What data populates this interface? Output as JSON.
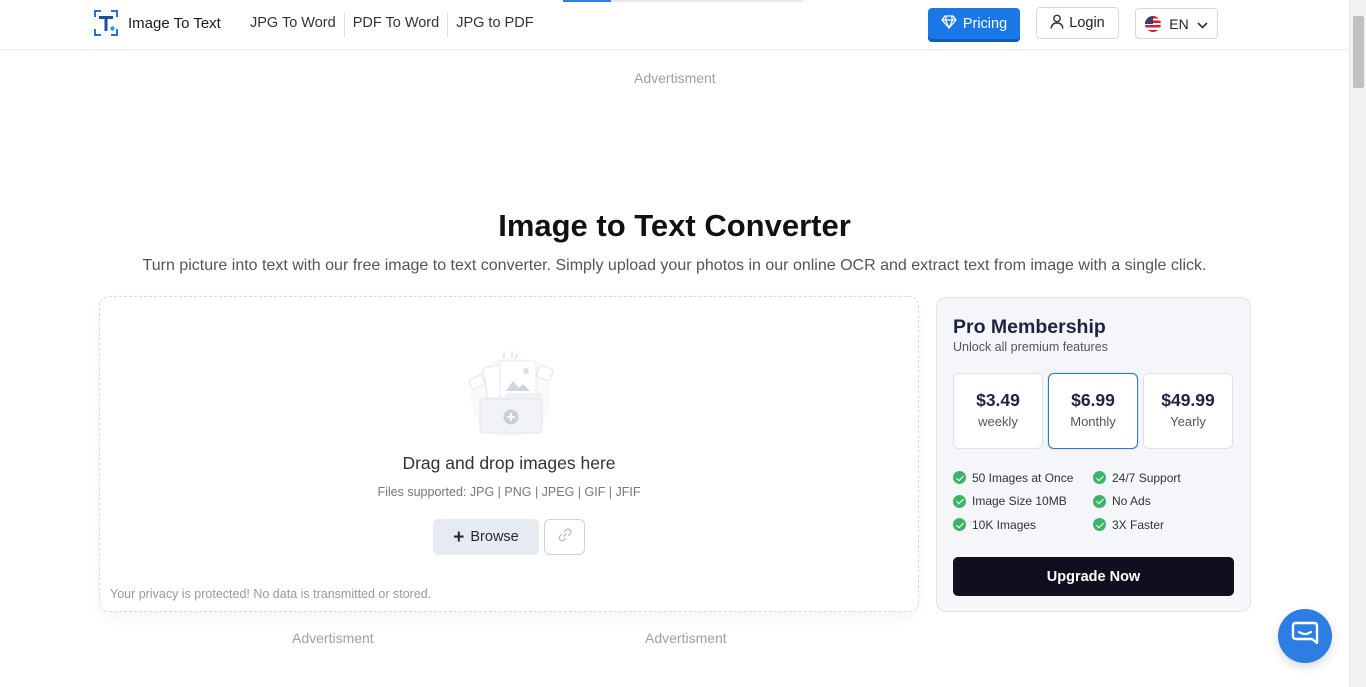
{
  "header": {
    "logo_text": "Image To Text",
    "nav": [
      {
        "label": "JPG To Word"
      },
      {
        "label": "PDF To Word"
      },
      {
        "label": "JPG to PDF"
      }
    ],
    "pricing_label": "Pricing",
    "login_label": "Login",
    "language": "EN",
    "colors": {
      "accent": "#1a78e6"
    }
  },
  "ads": {
    "top": "Advertisment",
    "bottom_left": "Advertisment",
    "bottom_right": "Advertisment"
  },
  "hero": {
    "title": "Image to Text Converter",
    "subtitle": "Turn picture into text with our free image to text converter. Simply upload your photos in our online OCR and extract text from image with a single click."
  },
  "upload": {
    "drop_text": "Drag and drop images here",
    "files_supported": "Files supported: JPG | PNG | JPEG | GIF | JFIF",
    "browse_label": "Browse",
    "privacy": "Your privacy is protected! No data is transmitted or stored."
  },
  "pro": {
    "title": "Pro Membership",
    "subtitle": "Unlock all premium features",
    "plans": [
      {
        "price": "$3.49",
        "period": "weekly"
      },
      {
        "price": "$6.99",
        "period": "Monthly"
      },
      {
        "price": "$49.99",
        "period": "Yearly"
      }
    ],
    "selected_plan": "Monthly",
    "features": [
      {
        "label": "50 Images at Once"
      },
      {
        "label": "24/7 Support"
      },
      {
        "label": "Image Size 10MB"
      },
      {
        "label": "No Ads"
      },
      {
        "label": "10K Images"
      },
      {
        "label": "3X Faster"
      }
    ],
    "upgrade_label": "Upgrade Now",
    "colors": {
      "check": "#3fb468",
      "selected_border": "#2c78d4",
      "upgrade_bg": "#0f0f1f"
    }
  },
  "icons": [
    "logo-icon",
    "diamond-icon",
    "user-icon",
    "us-flag-icon",
    "chevron-down-icon",
    "upload-folder-icon",
    "plus-icon",
    "link-icon",
    "check-icon",
    "chat-icon"
  ]
}
